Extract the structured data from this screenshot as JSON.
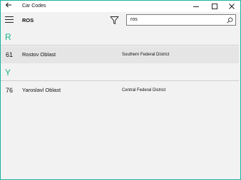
{
  "window": {
    "title": "Car Codes",
    "controls": {
      "minimize_icon": "minimize-icon",
      "maximize_icon": "maximize-icon",
      "close_icon": "close-icon"
    }
  },
  "toolbar": {
    "menu_icon": "hamburger-menu-icon",
    "page_title": "ROS",
    "filter_icon": "filter-icon",
    "search": {
      "value": "ros",
      "placeholder": "",
      "icon": "search-icon"
    }
  },
  "groups": [
    {
      "letter": "R",
      "items": [
        {
          "code": "61",
          "region": "Rostov Oblast",
          "district": "Southern Federal District",
          "selected": true
        }
      ]
    },
    {
      "letter": "Y",
      "items": [
        {
          "code": "76",
          "region": "Yaroslavl Oblast",
          "district": "Central Federal District",
          "selected": false
        }
      ]
    }
  ],
  "colors": {
    "accent": "#19b388",
    "window_border": "#19b3a1",
    "selected_row": "#e5e5e5",
    "background": "#f2f2f2"
  }
}
